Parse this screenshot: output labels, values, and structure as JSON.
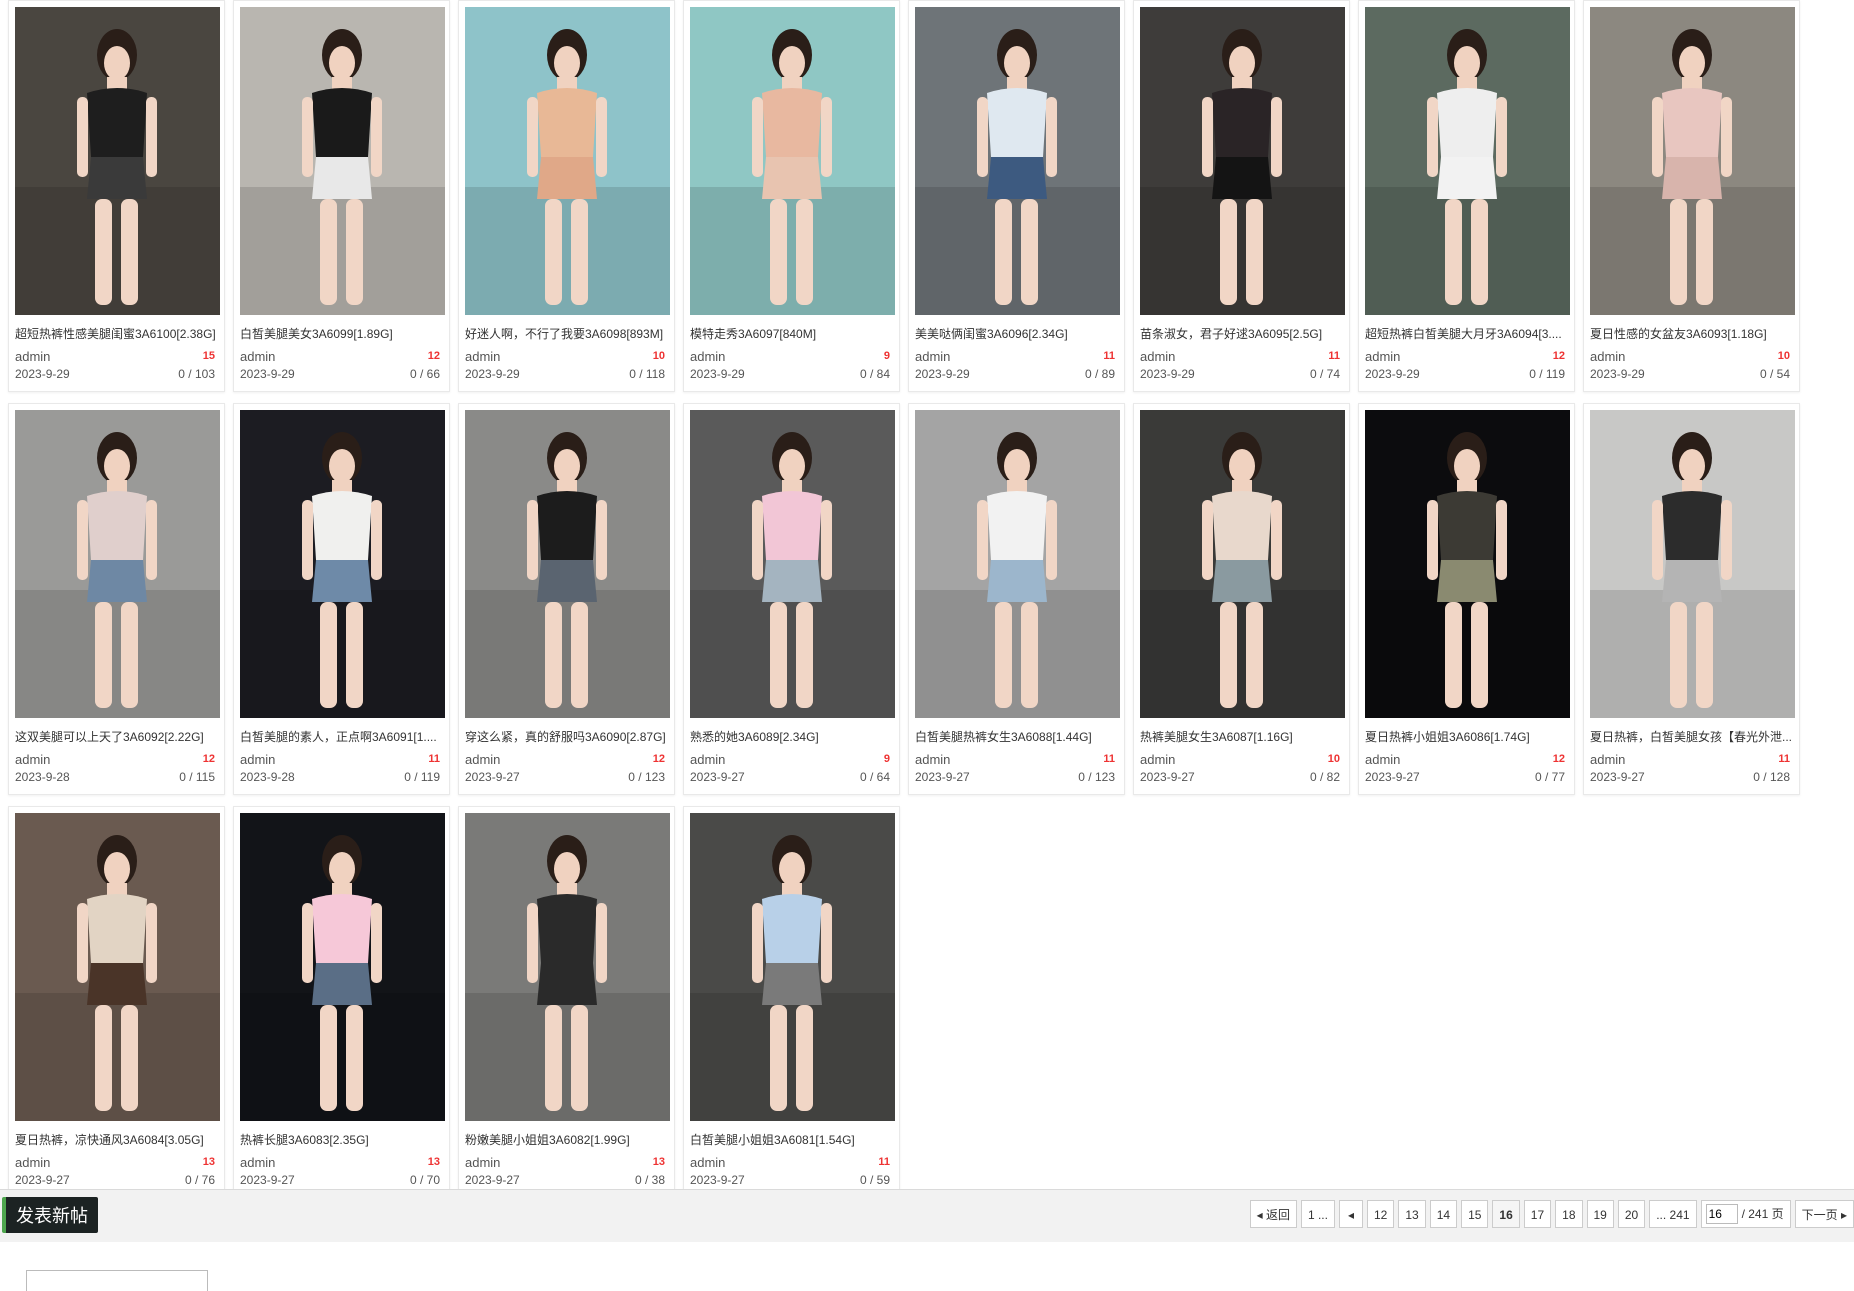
{
  "posts": [
    {
      "title": "超短热裤性感美腿闺蜜3A6100[2.38G]",
      "author": "admin",
      "replies": "15",
      "date": "2023-9-29",
      "views": "0 / 103"
    },
    {
      "title": "白皙美腿美女3A6099[1.89G]",
      "author": "admin",
      "replies": "12",
      "date": "2023-9-29",
      "views": "0 / 66"
    },
    {
      "title": "好迷人啊，不行了我要3A6098[893M]",
      "author": "admin",
      "replies": "10",
      "date": "2023-9-29",
      "views": "0 / 118"
    },
    {
      "title": "模特走秀3A6097[840M]",
      "author": "admin",
      "replies": "9",
      "date": "2023-9-29",
      "views": "0 / 84"
    },
    {
      "title": "美美哒俩闺蜜3A6096[2.34G]",
      "author": "admin",
      "replies": "11",
      "date": "2023-9-29",
      "views": "0 / 89"
    },
    {
      "title": "苗条淑女，君子好逑3A6095[2.5G]",
      "author": "admin",
      "replies": "11",
      "date": "2023-9-29",
      "views": "0 / 74"
    },
    {
      "title": "超短热裤白皙美腿大月牙3A6094[3....",
      "author": "admin",
      "replies": "12",
      "date": "2023-9-29",
      "views": "0 / 119"
    },
    {
      "title": "夏日性感的女盆友3A6093[1.18G]",
      "author": "admin",
      "replies": "10",
      "date": "2023-9-29",
      "views": "0 / 54"
    },
    {
      "title": "这双美腿可以上天了3A6092[2.22G]",
      "author": "admin",
      "replies": "12",
      "date": "2023-9-28",
      "views": "0 / 115"
    },
    {
      "title": "白皙美腿的素人，正点啊3A6091[1....",
      "author": "admin",
      "replies": "11",
      "date": "2023-9-28",
      "views": "0 / 119"
    },
    {
      "title": "穿这么紧，真的舒服吗3A6090[2.87G]",
      "author": "admin",
      "replies": "12",
      "date": "2023-9-27",
      "views": "0 / 123"
    },
    {
      "title": "熟悉的她3A6089[2.34G]",
      "author": "admin",
      "replies": "9",
      "date": "2023-9-27",
      "views": "0 / 64"
    },
    {
      "title": "白皙美腿热裤女生3A6088[1.44G]",
      "author": "admin",
      "replies": "11",
      "date": "2023-9-27",
      "views": "0 / 123"
    },
    {
      "title": "热裤美腿女生3A6087[1.16G]",
      "author": "admin",
      "replies": "10",
      "date": "2023-9-27",
      "views": "0 / 82"
    },
    {
      "title": "夏日热裤小姐姐3A6086[1.74G]",
      "author": "admin",
      "replies": "12",
      "date": "2023-9-27",
      "views": "0 / 77"
    },
    {
      "title": "夏日热裤，白皙美腿女孩【春光外泄...",
      "author": "admin",
      "replies": "11",
      "date": "2023-9-27",
      "views": "0 / 128"
    },
    {
      "title": "夏日热裤，凉快通风3A6084[3.05G]",
      "author": "admin",
      "replies": "13",
      "date": "2023-9-27",
      "views": "0 / 76"
    },
    {
      "title": "热裤长腿3A6083[2.35G]",
      "author": "admin",
      "replies": "13",
      "date": "2023-9-27",
      "views": "0 / 70"
    },
    {
      "title": "粉嫩美腿小姐姐3A6082[1.99G]",
      "author": "admin",
      "replies": "13",
      "date": "2023-9-27",
      "views": "0 / 38"
    },
    {
      "title": "白皙美腿小姐姐3A6081[1.54G]",
      "author": "admin",
      "replies": "11",
      "date": "2023-9-27",
      "views": "0 / 59"
    }
  ],
  "thumb_colors": [
    {
      "bg": "#4a4640",
      "top": "#1e1e1e",
      "bottom": "#3a3a3a"
    },
    {
      "bg": "#b9b6b0",
      "top": "#1a1a1a",
      "bottom": "#e8e8e8"
    },
    {
      "bg": "#8ec3c9",
      "top": "#e8b896",
      "bottom": "#e0a888"
    },
    {
      "bg": "#8fc7c4",
      "top": "#e8b8a0",
      "bottom": "#e8c4b0"
    },
    {
      "bg": "#6e7478",
      "top": "#dfe8f0",
      "bottom": "#3d5a80"
    },
    {
      "bg": "#3e3c3a",
      "top": "#2a2426",
      "bottom": "#141414"
    },
    {
      "bg": "#5c6a60",
      "top": "#eeeeee",
      "bottom": "#f2f2f2"
    },
    {
      "bg": "#8c8880",
      "top": "#e8c6c0",
      "bottom": "#d8b4ac"
    },
    {
      "bg": "#9a9a98",
      "top": "#e0cfcc",
      "bottom": "#6e88a4"
    },
    {
      "bg": "#1c1c22",
      "top": "#f0f0ee",
      "bottom": "#6e8aa8"
    },
    {
      "bg": "#8a8a88",
      "top": "#1c1c1c",
      "bottom": "#5a6470"
    },
    {
      "bg": "#5a5a5a",
      "top": "#f2c6d6",
      "bottom": "#a4b4c0"
    },
    {
      "bg": "#a4a4a4",
      "top": "#f2f2f2",
      "bottom": "#9cb6cc"
    },
    {
      "bg": "#3a3a38",
      "top": "#e8d8cc",
      "bottom": "#8a9aa0"
    },
    {
      "bg": "#0c0c0e",
      "top": "#3c3a34",
      "bottom": "#8a8a70"
    },
    {
      "bg": "#c8c8c6",
      "top": "#2c2c2c",
      "bottom": "#b4b4b4"
    },
    {
      "bg": "#6a5a50",
      "top": "#e2d4c4",
      "bottom": "#4a3428"
    },
    {
      "bg": "#121418",
      "top": "#f6c8d8",
      "bottom": "#5a6e86"
    },
    {
      "bg": "#7a7a78",
      "top": "#2a2a2a",
      "bottom": "#2a2a2a"
    },
    {
      "bg": "#4a4a48",
      "top": "#b8d0e8",
      "bottom": "#7a7a7a"
    }
  ],
  "toolbar": {
    "new_post": "发表新帖"
  },
  "pager": {
    "back": "返回",
    "first": "1 ...",
    "pages": [
      "12",
      "13",
      "14",
      "15",
      "16",
      "17",
      "18",
      "19",
      "20"
    ],
    "current": "16",
    "last": "... 241",
    "input_value": "16",
    "total": "/ 241 页",
    "next": "下一页"
  }
}
